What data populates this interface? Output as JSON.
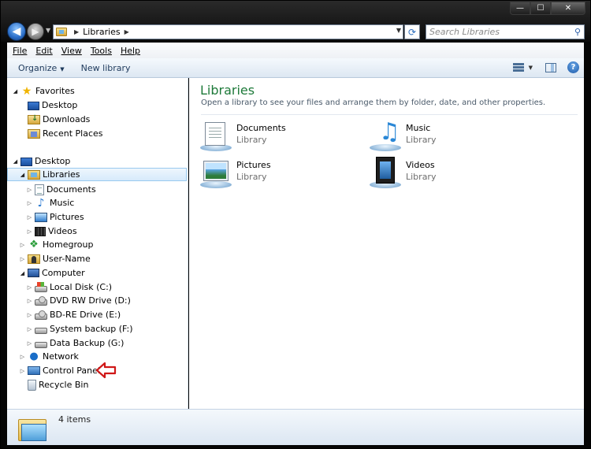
{
  "window": {
    "minimize": "—",
    "maximize": "☐",
    "close": "✕"
  },
  "address": {
    "crumb": "Libraries"
  },
  "search": {
    "placeholder": "Search Libraries"
  },
  "menubar": [
    "File",
    "Edit",
    "View",
    "Tools",
    "Help"
  ],
  "toolbar": {
    "organize": "Organize",
    "new_library": "New library"
  },
  "nav": {
    "favorites": "Favorites",
    "desktop_fav": "Desktop",
    "downloads": "Downloads",
    "recent_places": "Recent Places",
    "desktop": "Desktop",
    "libraries": "Libraries",
    "documents": "Documents",
    "music": "Music",
    "pictures": "Pictures",
    "videos": "Videos",
    "homegroup": "Homegroup",
    "user_name": "User-Name",
    "computer": "Computer",
    "local_disk": "Local Disk (C:)",
    "dvd_drive": "DVD RW Drive (D:)",
    "bd_drive": "BD-RE Drive (E:)",
    "system_backup": "System backup (F:)",
    "data_backup": "Data Backup (G:)",
    "network": "Network",
    "control_panel": "Control Panel",
    "recycle_bin": "Recycle Bin"
  },
  "content": {
    "title": "Libraries",
    "subtitle": "Open a library to see your files and arrange them by folder, date, and other properties.",
    "libraries": [
      {
        "name": "Documents",
        "kind": "Library"
      },
      {
        "name": "Music",
        "kind": "Library"
      },
      {
        "name": "Pictures",
        "kind": "Library"
      },
      {
        "name": "Videos",
        "kind": "Library"
      }
    ]
  },
  "details": {
    "count": "4 items"
  },
  "colors": {
    "accent_green": "#1e7a3a",
    "selection": "#d6eafb",
    "annotation_red": "#d01818"
  }
}
